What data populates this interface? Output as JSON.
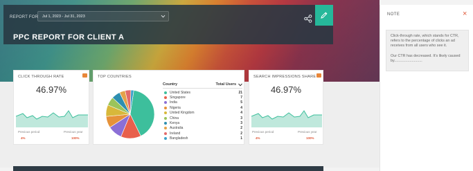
{
  "header": {
    "report_for_label": "REPORT FOR",
    "date_range": "Jul 1, 2023 - Jul 31, 2023",
    "title": "PPC REPORT FOR CLIENT A",
    "accent_color": "#26b89a"
  },
  "widgets": {
    "ctr": {
      "title": "CLICK THROUGH RATE",
      "value": "46.97%",
      "prev_period_label": "Previous period",
      "prev_year_label": "Previous year",
      "prev_period_value": "4%",
      "prev_year_value": "100%"
    },
    "countries": {
      "title": "TOP COUNTRIES",
      "col_country": "Country",
      "col_users": "Total Users",
      "rows": [
        {
          "name": "United States",
          "value": "21",
          "color": "#3dbf9c"
        },
        {
          "name": "Singapore",
          "value": "7",
          "color": "#e8604c"
        },
        {
          "name": "India",
          "value": "5",
          "color": "#8b6fd6"
        },
        {
          "name": "Nigeria",
          "value": "4",
          "color": "#e6923a"
        },
        {
          "name": "United Kingdom",
          "value": "4",
          "color": "#d8b83a"
        },
        {
          "name": "China",
          "value": "3",
          "color": "#9bc45a"
        },
        {
          "name": "Kenya",
          "value": "3",
          "color": "#2e8fb0"
        },
        {
          "name": "Australia",
          "value": "2",
          "color": "#e4a24a"
        },
        {
          "name": "Ireland",
          "value": "2",
          "color": "#e26a6a"
        },
        {
          "name": "Bangladesh",
          "value": "1",
          "color": "#3aa2c9"
        }
      ]
    },
    "impr": {
      "title": "SEARCH IMPRESSIONS SHARE",
      "value": "46.97%",
      "prev_period_label": "Previous period",
      "prev_year_label": "Previous year",
      "prev_period_value": "4%",
      "prev_year_value": "100%"
    }
  },
  "note": {
    "title": "NOTE",
    "p1": "Click-through rate, which stands for CTR, refers to the percentage of clicks an ad receives from all users who see it.",
    "p2": "Our CTR has decreased. It's likely caused by..........................."
  }
}
